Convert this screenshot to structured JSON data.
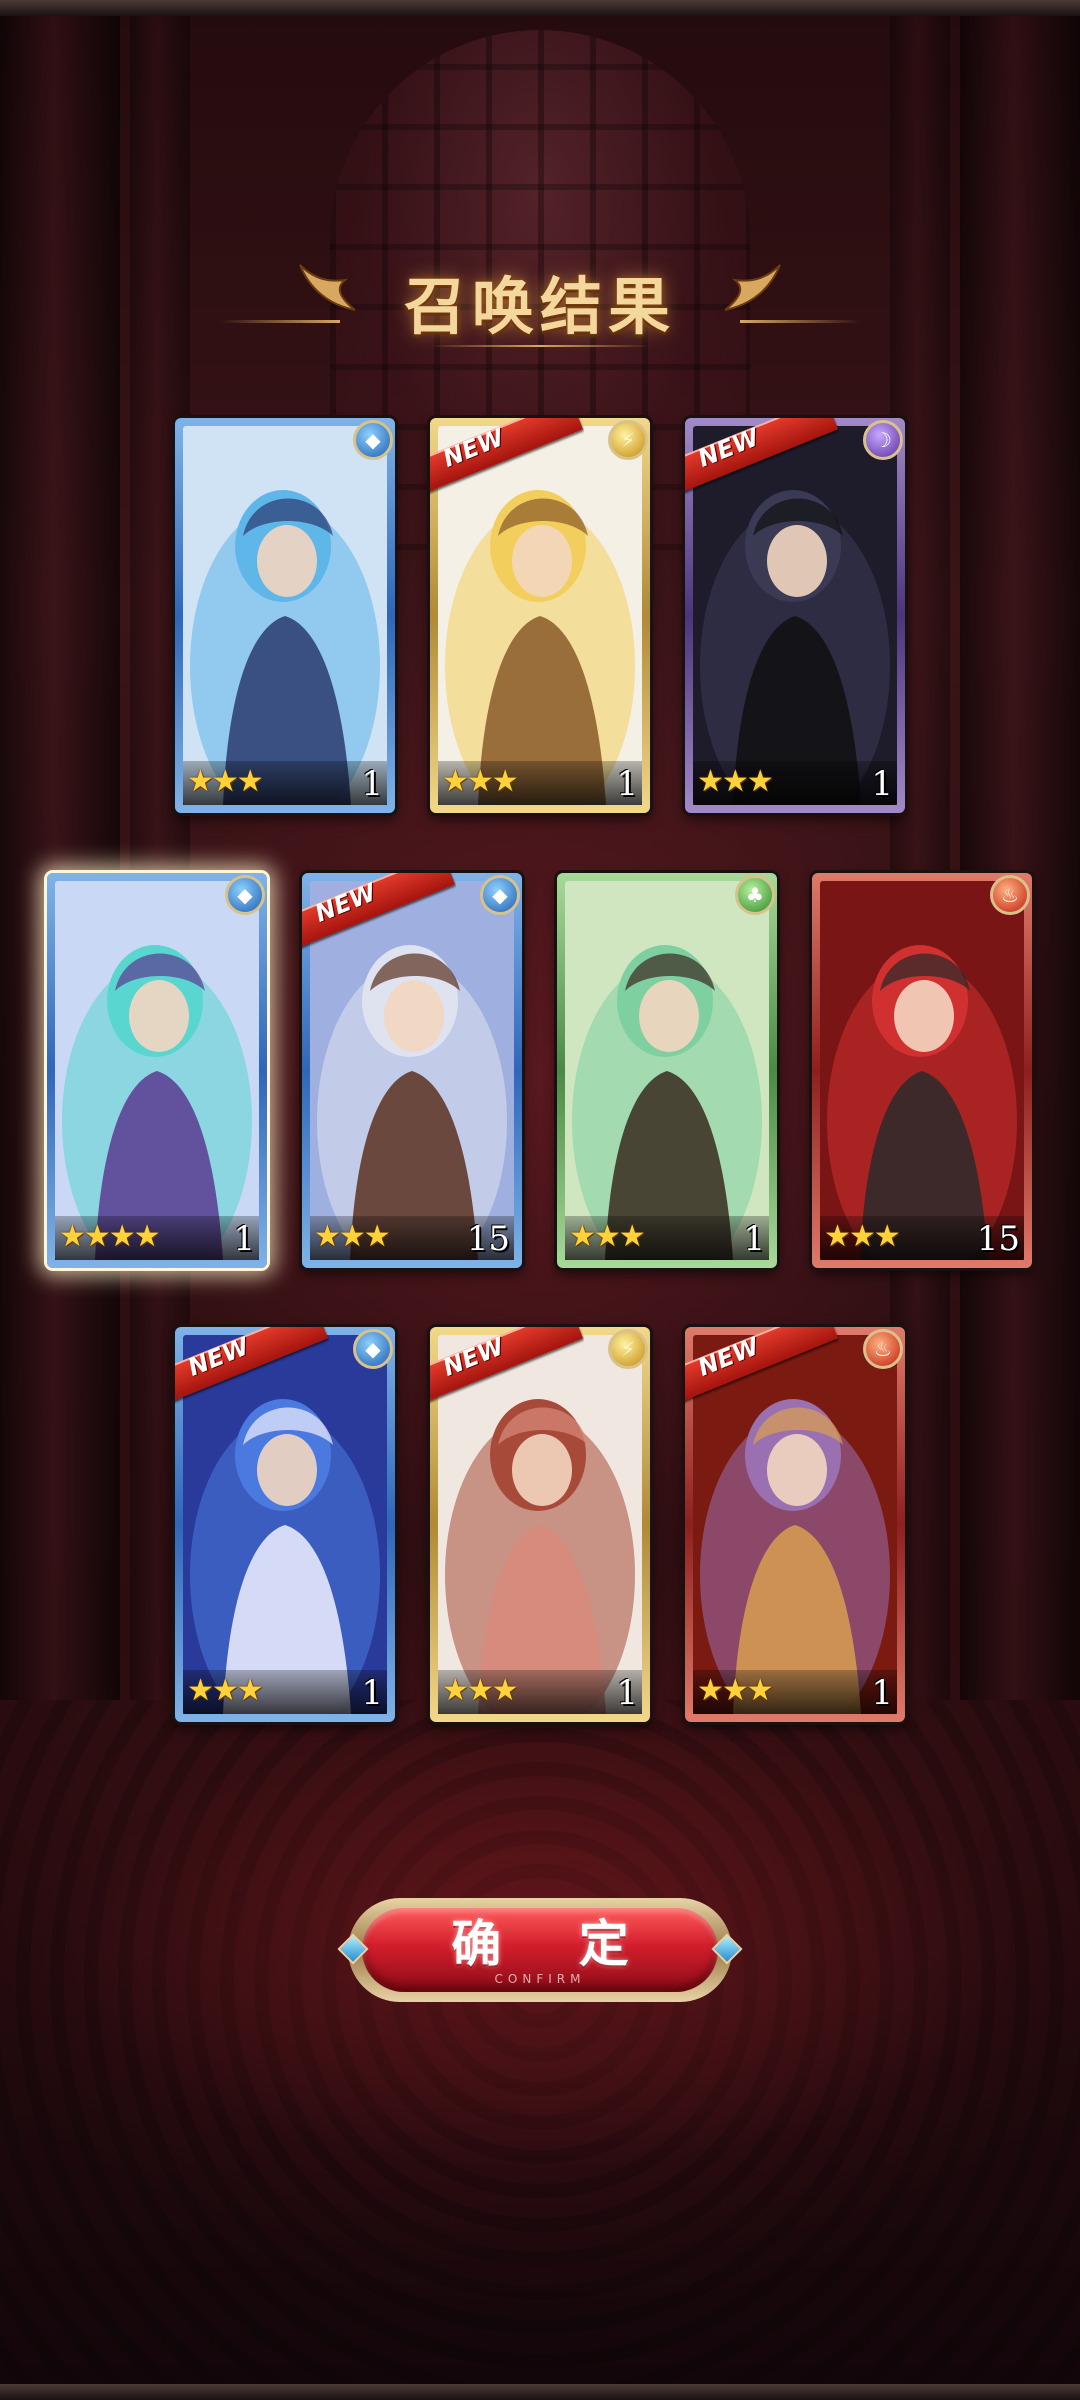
{
  "title": "召唤结果",
  "cards": [
    {
      "element": "water",
      "element_icon": "water-drop-icon",
      "new": false,
      "stars": 3,
      "stars_text": "★★★",
      "count": "1",
      "palette": [
        "#cfe3f5",
        "#5fb6e8",
        "#2a3b70"
      ]
    },
    {
      "element": "light",
      "element_icon": "lightning-icon",
      "new": true,
      "stars": 3,
      "stars_text": "★★★",
      "count": "1",
      "palette": [
        "#f4f0e6",
        "#f2cf5c",
        "#8a5a2a"
      ]
    },
    {
      "element": "dark",
      "element_icon": "moon-icon",
      "new": true,
      "stars": 3,
      "stars_text": "★★★",
      "count": "1",
      "palette": [
        "#1e1c2a",
        "#3a3a55",
        "#111111"
      ]
    },
    {
      "element": "water",
      "element_icon": "water-drop-icon",
      "new": false,
      "stars": 4,
      "stars_text": "★★★★",
      "count": "1",
      "palette": [
        "#c8d8f5",
        "#5ad6d0",
        "#5a3a90"
      ]
    },
    {
      "element": "water",
      "element_icon": "water-drop-icon",
      "new": true,
      "stars": 3,
      "stars_text": "★★★",
      "count": "15",
      "palette": [
        "#9fb0e0",
        "#dfe3f0",
        "#5a3020"
      ]
    },
    {
      "element": "wood",
      "element_icon": "leaf-icon",
      "new": false,
      "stars": 3,
      "stars_text": "★★★",
      "count": "1",
      "palette": [
        "#cfe6c0",
        "#7fd0a0",
        "#3a2a20"
      ]
    },
    {
      "element": "fire",
      "element_icon": "fire-icon",
      "new": false,
      "stars": 3,
      "stars_text": "★★★",
      "count": "15",
      "palette": [
        "#7a1515",
        "#d03030",
        "#2a2a2a"
      ]
    },
    {
      "element": "water",
      "element_icon": "water-drop-icon",
      "new": true,
      "stars": 3,
      "stars_text": "★★★",
      "count": "1",
      "palette": [
        "#2a3a9a",
        "#4a7ae0",
        "#f0f0ff"
      ]
    },
    {
      "element": "light",
      "element_icon": "lightning-icon",
      "new": true,
      "stars": 3,
      "stars_text": "★★★",
      "count": "1",
      "palette": [
        "#f0e8e0",
        "#a84a3a",
        "#d88a7a"
      ]
    },
    {
      "element": "fire",
      "element_icon": "fire-icon",
      "new": true,
      "stars": 3,
      "stars_text": "★★★",
      "count": "1",
      "palette": [
        "#7a1a10",
        "#9a70b0",
        "#d8a050"
      ]
    }
  ],
  "new_label": "NEW",
  "confirm_button": {
    "label": "确 定",
    "sublabel": "CONFIRM"
  }
}
